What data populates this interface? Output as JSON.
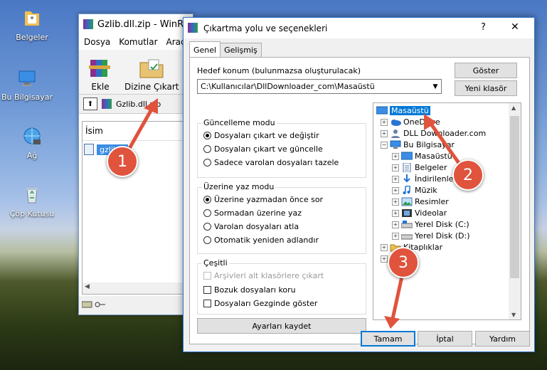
{
  "desktop": {
    "icons": [
      {
        "label": "Belgeler",
        "icon": "folder-documents-icon"
      },
      {
        "label": "Bu Bilgisayar",
        "icon": "computer-icon"
      },
      {
        "label": "Ağ",
        "icon": "network-icon"
      },
      {
        "label": "Çöp Kutusu",
        "icon": "recycle-bin-icon"
      }
    ]
  },
  "winrar": {
    "title": "Gzlib.dll.zip - WinRA",
    "menu": [
      "Dosya",
      "Komutlar",
      "Araçla"
    ],
    "toolbar": {
      "add_label": "Ekle",
      "extract_label": "Dizine Çıkart"
    },
    "path": "Gzlib.dll.zip",
    "column_name": "İsim",
    "file": "gzlib.d"
  },
  "dialog": {
    "title": "Çıkartma yolu ve seçenekleri",
    "help_label": "?",
    "close_label": "✕",
    "tabs": [
      "Genel",
      "Gelişmiş"
    ],
    "dest_label": "Hedef konum (bulunmazsa oluşturulacak)",
    "dest_value": "C:\\Kullanıcılar\\DllDownloader_com\\Masaüstü",
    "show_label": "Göster",
    "new_folder_label": "Yeni klasör",
    "update_group": {
      "label": "Güncelleme modu",
      "options": [
        "Dosyaları çıkart ve değiştir",
        "Dosyaları çıkart ve güncelle",
        "Sadece varolan dosyaları tazele"
      ],
      "selected": 0
    },
    "overwrite_group": {
      "label": "Üzerine yaz modu",
      "options": [
        "Üzerine yazmadan önce sor",
        "Sormadan üzerine yaz",
        "Varolan dosyaları atla",
        "Otomatik yeniden adlandır"
      ],
      "selected": 0
    },
    "misc_group": {
      "label": "Çeşitli",
      "options": [
        {
          "label": "Arşivleri alt klasörlere çıkart",
          "disabled": true
        },
        {
          "label": "Bozuk dosyaları koru",
          "disabled": false
        },
        {
          "label": "Dosyaları Gezginde göster",
          "disabled": false
        }
      ]
    },
    "save_settings_label": "Ayarları kaydet",
    "tree": [
      {
        "label": "Masaüstü",
        "level": 0,
        "selected": true,
        "icon": "desktop-icon"
      },
      {
        "label": "OneDrive",
        "level": 1,
        "icon": "onedrive-icon"
      },
      {
        "label": "DLL Downloader.com",
        "level": 1,
        "icon": "user-icon"
      },
      {
        "label": "Bu Bilgisayar",
        "level": 1,
        "icon": "computer-icon"
      },
      {
        "label": "Masaüstü",
        "level": 2,
        "icon": "desktop-icon"
      },
      {
        "label": "Belgeler",
        "level": 2,
        "icon": "documents-icon"
      },
      {
        "label": "İndirilenler",
        "level": 2,
        "icon": "downloads-icon"
      },
      {
        "label": "Müzik",
        "level": 2,
        "icon": "music-icon"
      },
      {
        "label": "Resimler",
        "level": 2,
        "icon": "pictures-icon"
      },
      {
        "label": "Videolar",
        "level": 2,
        "icon": "videos-icon"
      },
      {
        "label": "Yerel Disk (C:)",
        "level": 2,
        "icon": "drive-icon"
      },
      {
        "label": "Yerel Disk (D:)",
        "level": 2,
        "icon": "drive-icon"
      },
      {
        "label": "Kitaplıklar",
        "level": 1,
        "icon": "libraries-icon"
      }
    ],
    "ok_label": "Tamam",
    "cancel_label": "İptal",
    "help_button_label": "Yardım"
  },
  "markers": [
    "1",
    "2",
    "3"
  ],
  "colors": {
    "accent": "#0078d7",
    "marker": "#e0533d",
    "arrow": "#e0533d"
  }
}
